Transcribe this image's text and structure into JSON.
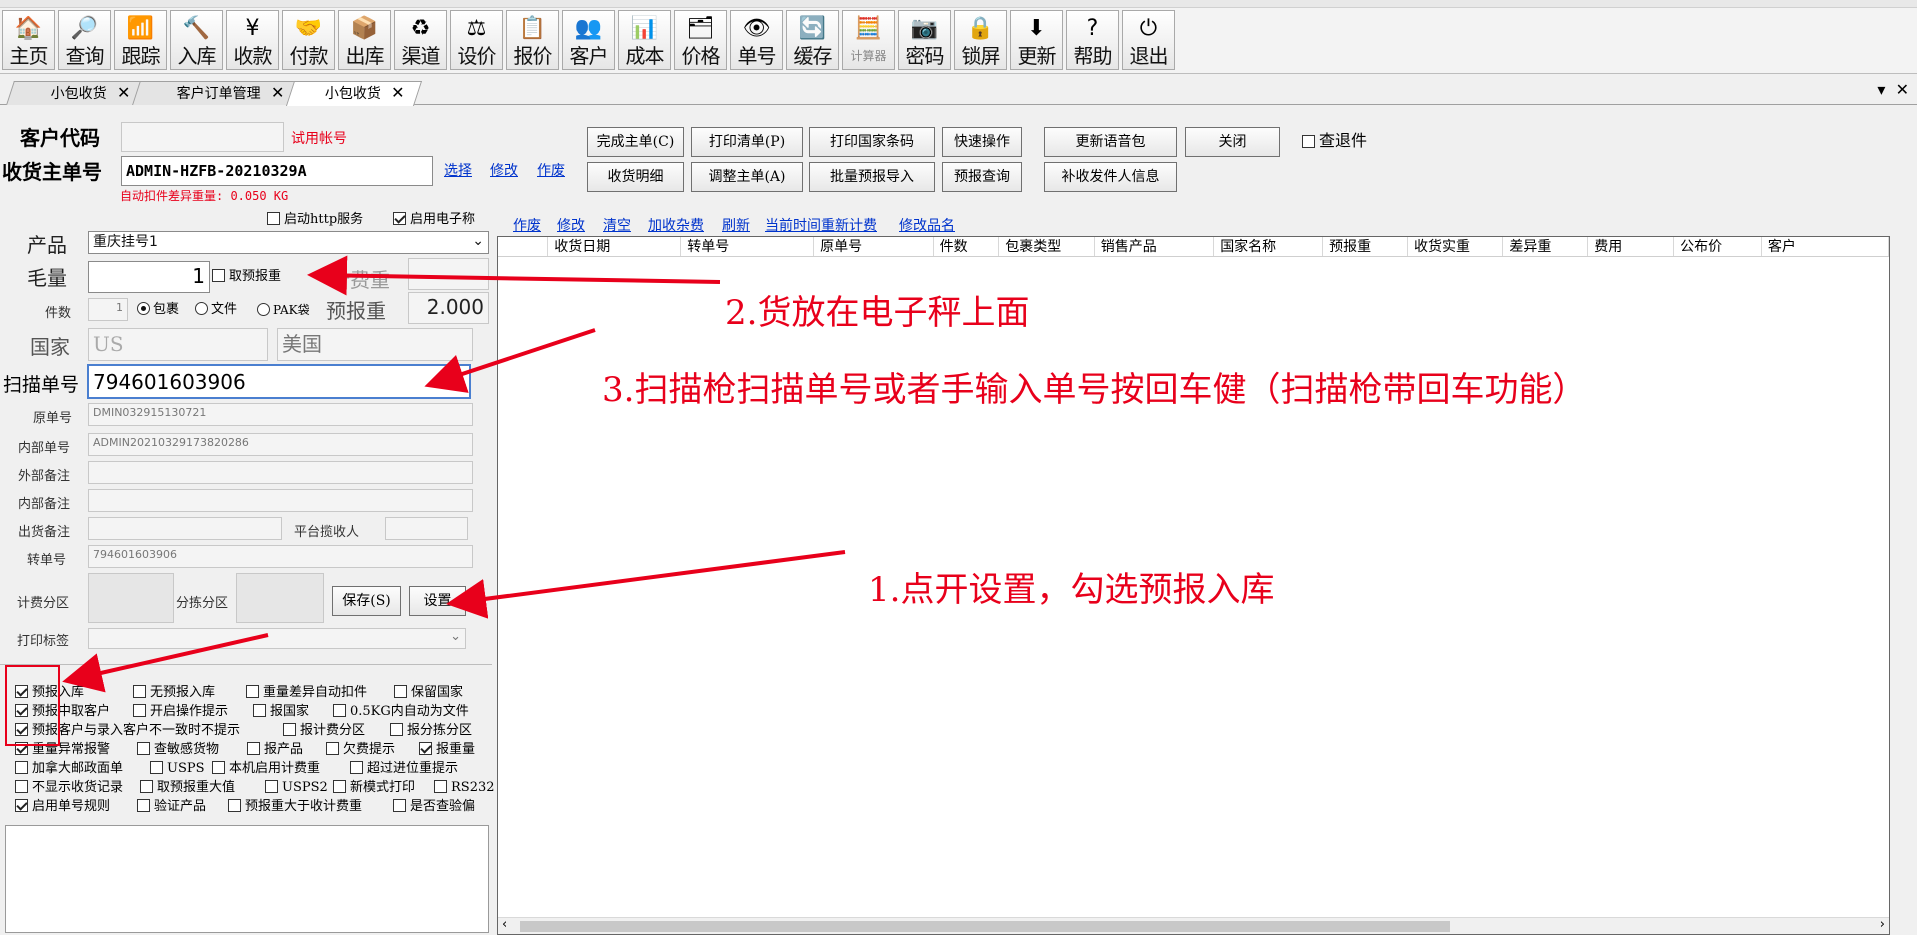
{
  "toolbar": [
    {
      "label": "主页",
      "icon": "house-icon",
      "glyph": "🏠"
    },
    {
      "label": "查询",
      "icon": "magnifier-icon",
      "glyph": "🔎"
    },
    {
      "label": "跟踪",
      "icon": "wifi-icon",
      "glyph": "📶"
    },
    {
      "label": "入库",
      "icon": "hammer-icon",
      "glyph": "🔨"
    },
    {
      "label": "收款",
      "icon": "yen-icon",
      "glyph": "¥"
    },
    {
      "label": "付款",
      "icon": "handshake-icon",
      "glyph": "🤝"
    },
    {
      "label": "出库",
      "icon": "box-icon",
      "glyph": "📦"
    },
    {
      "label": "渠道",
      "icon": "cycle-icon",
      "glyph": "♻"
    },
    {
      "label": "设价",
      "icon": "scale-icon",
      "glyph": "⚖"
    },
    {
      "label": "报价",
      "icon": "price-box-icon",
      "glyph": "📋"
    },
    {
      "label": "客户",
      "icon": "users-icon",
      "glyph": "👥"
    },
    {
      "label": "成本",
      "icon": "bar-chart-icon",
      "glyph": "📊"
    },
    {
      "label": "价格",
      "icon": "tag-icon",
      "glyph": "🗂"
    },
    {
      "label": "单号",
      "icon": "eye-icon",
      "glyph": "👁"
    },
    {
      "label": "缓存",
      "icon": "refresh-icon",
      "glyph": "🔄"
    },
    {
      "label": "计算器",
      "icon": "calculator-icon",
      "glyph": "🧮",
      "small": true
    },
    {
      "label": "密码",
      "icon": "camera-icon",
      "glyph": "📷"
    },
    {
      "label": "锁屏",
      "icon": "lock-icon",
      "glyph": "🔒"
    },
    {
      "label": "更新",
      "icon": "download-arrow-icon",
      "glyph": "⬇"
    },
    {
      "label": "帮助",
      "icon": "help-icon",
      "glyph": "?"
    },
    {
      "label": "退出",
      "icon": "power-icon",
      "glyph": "⏻"
    }
  ],
  "tabs": [
    {
      "label": "小包收货",
      "active": false
    },
    {
      "label": "客户订单管理",
      "active": false
    },
    {
      "label": "小包收货",
      "active": true
    }
  ],
  "header": {
    "customer_code_label": "客户代码",
    "customer_code_value": "",
    "trial_account": "试用帐号",
    "master_no_label": "收货主单号",
    "master_no_value": "ADMIN-HZFB-20210329A",
    "link_select": "选择",
    "link_edit": "修改",
    "link_void": "作废",
    "auto_weight_note": "自动扣件差异重量: 0.050 KG"
  },
  "actions": {
    "complete": "完成主单(C)",
    "print_list": "打印清单(P)",
    "print_country": "打印国家条码",
    "quick_op": "快速操作",
    "update_voice": "更新语音包",
    "close": "关闭",
    "check_returned": "查退件",
    "receipt_detail": "收货明细",
    "adjust_master": "调整主单(A)",
    "batch_import": "批量预报导入",
    "forecast_query": "预报查询",
    "resupply_sender": "补收发件人信息"
  },
  "form": {
    "http_service": "启动http服务",
    "electronic_scale": "启用电子称",
    "product_label": "产品",
    "product_value": "重庆挂号1",
    "gross_label": "毛量",
    "gross_value": "1",
    "take_forecast": "取预报重",
    "billing_weight_label": "计费重",
    "pieces_label": "件数",
    "pieces_value": "1",
    "type_parcel": "包裹",
    "type_file": "文件",
    "type_pak": "PAK袋",
    "forecast_weight_label": "预报重",
    "forecast_weight_value": "2.000",
    "country_label": "国家",
    "country_code": "US",
    "country_name": "美国",
    "scan_label": "扫描单号",
    "scan_value": "794601603906",
    "original_no_label": "原单号",
    "original_no_value": "DMIN032915130721",
    "internal_no_label": "内部单号",
    "internal_no_value": "ADMIN20210329173820286",
    "ext_note_label": "外部备注",
    "int_note_label": "内部备注",
    "ship_note_label": "出货备注",
    "platform_receiver_label": "平台揽收人",
    "transfer_no_label": "转单号",
    "transfer_no_value": "794601603906",
    "billing_zone_label": "计费分区",
    "sort_zone_label": "分拣分区",
    "save": "保存(S)",
    "settings": "设置",
    "print_label": "打印标签"
  },
  "options": [
    {
      "label": "预报入库",
      "on": true
    },
    {
      "label": "无预报入库",
      "on": false
    },
    {
      "label": "重量差异自动扣件",
      "on": false
    },
    {
      "label": "保留国家",
      "on": false
    },
    {
      "label": "预报中取客户",
      "on": true
    },
    {
      "label": "开启操作提示",
      "on": false
    },
    {
      "label": "报国家",
      "on": false
    },
    {
      "label": "0.5KG内自动为文件",
      "on": false
    },
    {
      "label": "预报客户与录入客户不一致时不提示",
      "on": true
    },
    {
      "label": "报计费分区",
      "on": false
    },
    {
      "label": "报分拣分区",
      "on": false
    },
    {
      "label": "重量异常报警",
      "on": true
    },
    {
      "label": "查敏感货物",
      "on": false
    },
    {
      "label": "报产品",
      "on": false
    },
    {
      "label": "欠费提示",
      "on": false
    },
    {
      "label": "报重量",
      "on": true
    },
    {
      "label": "加拿大邮政面单",
      "on": false
    },
    {
      "label": "USPS",
      "on": false
    },
    {
      "label": "本机启用计费重",
      "on": false
    },
    {
      "label": "超过进位重提示",
      "on": false
    },
    {
      "label": "不显示收货记录",
      "on": false
    },
    {
      "label": "取预报重大值",
      "on": false
    },
    {
      "label": "USPS2",
      "on": false
    },
    {
      "label": "新模式打印",
      "on": false
    },
    {
      "label": "RS232",
      "on": false
    },
    {
      "label": "启用单号规则",
      "on": true
    },
    {
      "label": "验证产品",
      "on": false
    },
    {
      "label": "预报重大于收计费重",
      "on": false
    },
    {
      "label": "是否查验偏",
      "on": false
    }
  ],
  "grid_links": [
    "作废",
    "修改",
    "清空",
    "加收杂费",
    "刷新",
    "当前时间重新计费",
    "修改品名"
  ],
  "grid_columns": [
    "收货日期",
    "转单号",
    "原单号",
    "件数",
    "包裹类型",
    "销售产品",
    "国家名称",
    "预报重",
    "收货实重",
    "差异重",
    "费用",
    "公布价",
    "客户"
  ],
  "annotations": {
    "step1": "1.点开设置，勾选预报入库",
    "step2": "2.货放在电子秤上面",
    "step3": "3.扫描枪扫描单号或者手输入单号按回车健（扫描枪带回车功能）"
  },
  "colors": {
    "annotation": "#e8001b",
    "link": "#0033cc"
  }
}
